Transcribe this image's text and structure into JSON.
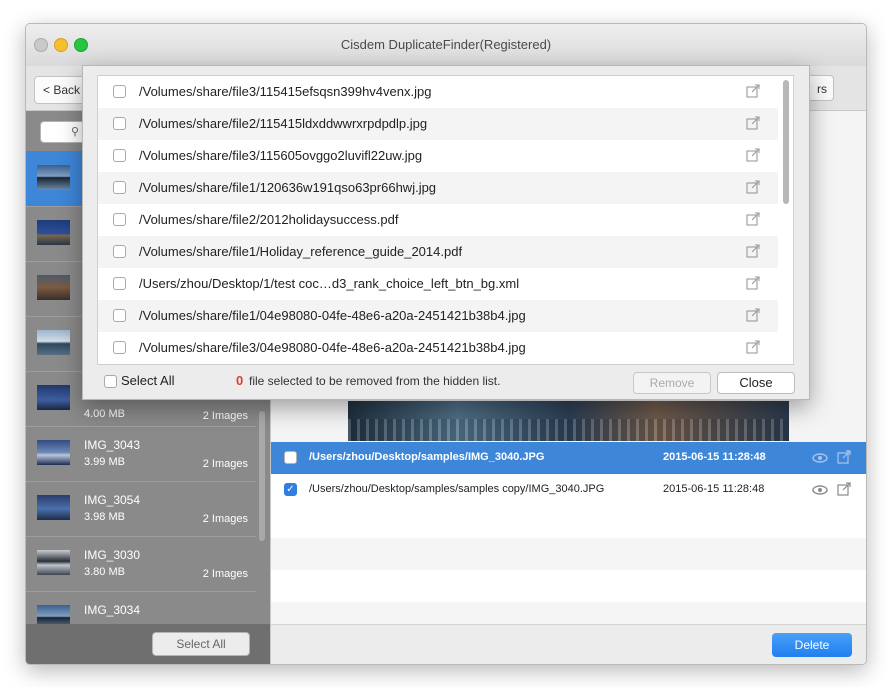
{
  "window": {
    "title": "Cisdem DuplicateFinder(Registered)"
  },
  "toolbar": {
    "back_label": "< Back",
    "right_button_label": "rs"
  },
  "sidebar": {
    "items": [
      {
        "name": "",
        "size": "",
        "count": "",
        "selected": true
      },
      {
        "name": "",
        "size": "",
        "count": ""
      },
      {
        "name": "",
        "size": "",
        "count": ""
      },
      {
        "name": "",
        "size": "",
        "count": ""
      },
      {
        "name": "",
        "size": "4.00 MB",
        "count": "2 Images"
      },
      {
        "name": "IMG_3043",
        "size": "3.99 MB",
        "count": "2 Images"
      },
      {
        "name": "IMG_3054",
        "size": "3.98 MB",
        "count": "2 Images"
      },
      {
        "name": "IMG_3030",
        "size": "3.80 MB",
        "count": "2 Images"
      },
      {
        "name": "IMG_3034",
        "size": "",
        "count": ""
      }
    ],
    "select_all_label": "Select All"
  },
  "main": {
    "files": [
      {
        "path": "/Users/zhou/Desktop/samples/IMG_3040.JPG",
        "date": "2015-06-15 11:28:48",
        "checked": false,
        "selected": true
      },
      {
        "path": "/Users/zhou/Desktop/samples/samples copy/IMG_3040.JPG",
        "date": "2015-06-15 11:28:48",
        "checked": true,
        "selected": false
      }
    ],
    "delete_label": "Delete"
  },
  "dialog": {
    "items": [
      "/Volumes/share/file3/115415efsqsn399hv4venx.jpg",
      "/Volumes/share/file2/115415ldxddwwrxrpdpdlp.jpg",
      "/Volumes/share/file3/115605ovggo2luvifl22uw.jpg",
      "/Volumes/share/file1/120636w191qso63pr66hwj.jpg",
      "/Volumes/share/file2/2012holidaysuccess.pdf",
      "/Volumes/share/file1/Holiday_reference_guide_2014.pdf",
      "/Users/zhou/Desktop/1/test coc…d3_rank_choice_left_btn_bg.xml",
      "/Volumes/share/file1/04e98080-04fe-48e6-a20a-2451421b38b4.jpg",
      "/Volumes/share/file3/04e98080-04fe-48e6-a20a-2451421b38b4.jpg"
    ],
    "select_all_label": "Select All",
    "selected_count": "0",
    "selected_text": "file selected to be removed from the hidden list.",
    "remove_label": "Remove",
    "close_label": "Close"
  },
  "colors": {
    "selection": "#3e86d8",
    "delete": "#1f7ff0",
    "count": "#e53b2c"
  }
}
